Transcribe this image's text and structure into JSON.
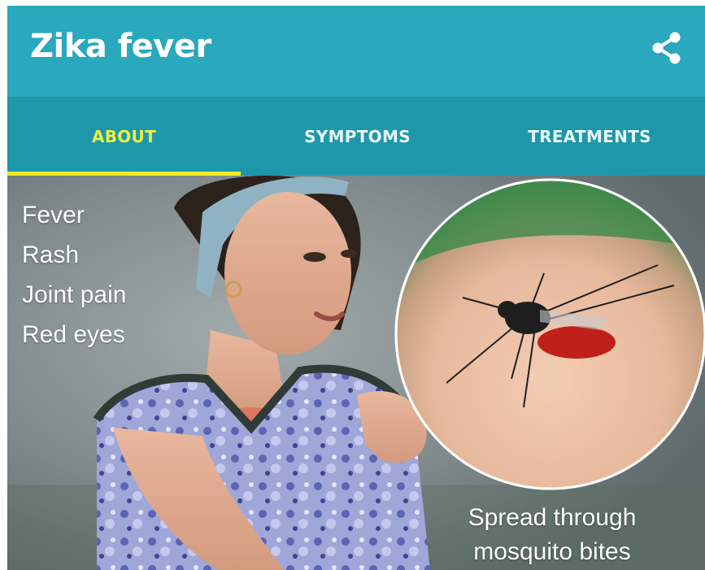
{
  "app": {
    "title": "Zika fever",
    "share_icon": "share-icon"
  },
  "tabs": [
    {
      "label": "ABOUT",
      "active": true
    },
    {
      "label": "SYMPTOMS",
      "active": false
    },
    {
      "label": "TREATMENTS",
      "active": false
    }
  ],
  "hero": {
    "symptoms": [
      "Fever",
      "Rash",
      "Joint pain",
      "Red eyes"
    ],
    "caption_line1": "Spread through",
    "caption_line2": "mosquito bites"
  },
  "colors": {
    "appbar": "#2aa8bd",
    "tabbar": "#1f97ab",
    "active_tab": "#eaf23f",
    "indicator": "#f1ea2a"
  }
}
